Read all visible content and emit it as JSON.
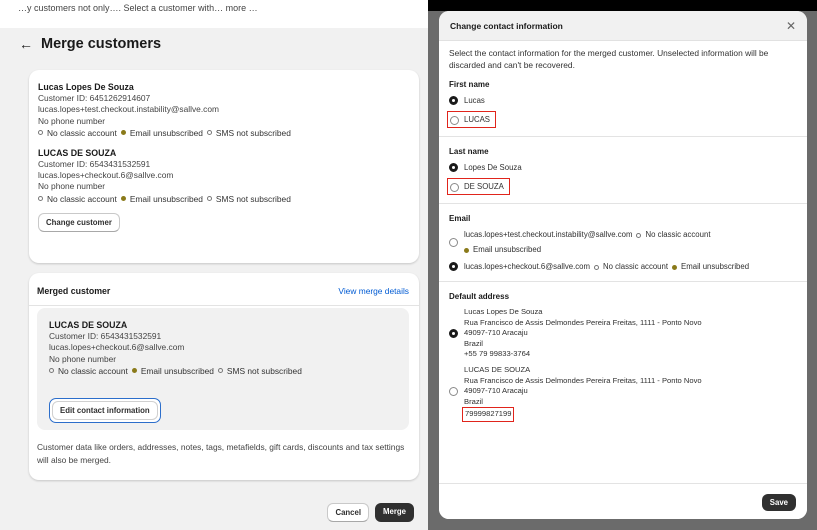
{
  "page": {
    "top_text": "…y customers not only…. Select a customer with… more …",
    "title": "Merge customers",
    "back_icon": "arrow-left-icon"
  },
  "customers": [
    {
      "name": "Lucas Lopes De Souza",
      "customer_id": "Customer ID: 6451262914607",
      "email": "lucas.lopes+test.checkout.instability@sallve.com",
      "phone": "No phone number",
      "classic": "No classic account",
      "email_status": "Email unsubscribed",
      "sms_status": "SMS not subscribed"
    },
    {
      "name": "LUCAS DE SOUZA",
      "customer_id": "Customer ID: 6543431532591",
      "email": "lucas.lopes+checkout.6@sallve.com",
      "phone": "No phone number",
      "classic": "No classic account",
      "email_status": "Email unsubscribed",
      "sms_status": "SMS not subscribed"
    }
  ],
  "change_customer_label": "Change customer",
  "merged": {
    "title": "Merged customer",
    "view_details_label": "View merge details",
    "name": "LUCAS DE SOUZA",
    "customer_id": "Customer ID: 6543431532591",
    "email": "lucas.lopes+checkout.6@sallve.com",
    "phone": "No phone number",
    "classic": "No classic account",
    "email_status": "Email unsubscribed",
    "sms_status": "SMS not subscribed",
    "edit_label": "Edit contact information",
    "footnote": "Customer data like orders, addresses, notes, tags, metafields, gift cards, discounts and tax settings will also be merged."
  },
  "actions": {
    "cancel": "Cancel",
    "merge": "Merge"
  },
  "modal": {
    "title": "Change contact information",
    "close_icon": "close-icon",
    "intro": "Select the contact information for the merged customer. Unselected information will be discarded and can't be recovered.",
    "first_name": {
      "label": "First name",
      "opt1": "Lucas",
      "opt2": "LUCAS"
    },
    "last_name": {
      "label": "Last name",
      "opt1": "Lopes De Souza",
      "opt2": "DE SOUZA"
    },
    "email": {
      "label": "Email",
      "opt1_email": "lucas.lopes+test.checkout.instability@sallve.com",
      "opt1_classic": "No classic account",
      "opt1_status": "Email unsubscribed",
      "opt2_email": "lucas.lopes+checkout.6@sallve.com",
      "opt2_classic": "No classic account",
      "opt2_status": "Email unsubscribed"
    },
    "address": {
      "label": "Default address",
      "opt1": {
        "name": "Lucas Lopes De Souza",
        "street": "Rua Francisco de Assis Delmondes Pereira Freitas, 1111 - Ponto Novo",
        "city": "49097-710 Aracaju",
        "country": "Brazil",
        "phone": "+55 79 99833-3764"
      },
      "opt2": {
        "name": "LUCAS DE SOUZA",
        "street": "Rua Francisco de Assis Delmondes Pereira Freitas, 1111 - Ponto Novo",
        "city": "49097-710 Aracaju",
        "country": "Brazil",
        "phone": "79999827199"
      }
    },
    "save_label": "Save"
  },
  "colors": {
    "highlight": "#e0241b",
    "link": "#005bd3",
    "primary": "#303030",
    "status_dot": "#8a7a1a"
  }
}
